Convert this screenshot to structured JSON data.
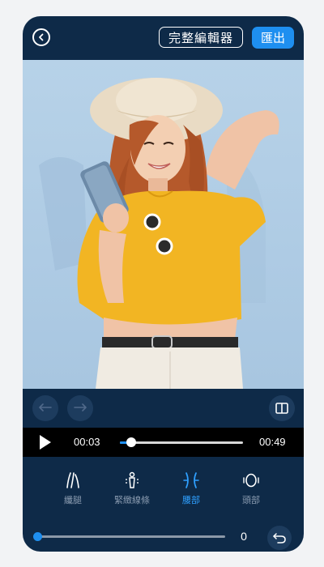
{
  "header": {
    "back_icon": "back-circle-icon",
    "full_editor_label": "完整編輯器",
    "export_label": "匯出"
  },
  "photo": {
    "description_icon": "portrait-photo",
    "colors": {
      "background": "#b4cfe6",
      "shirt": "#f2b523",
      "pants": "#f0ebe2",
      "hat": "#e9dbc4"
    }
  },
  "edit_toolbar": {
    "undo_icon": "undo-arrow-icon",
    "redo_icon": "redo-arrow-icon",
    "compare_icon": "split-compare-icon"
  },
  "player": {
    "play_icon": "play-icon",
    "current_time": "00:03",
    "duration": "00:49",
    "progress": 0.09
  },
  "tools": [
    {
      "label": "纖腿",
      "icon": "slim-legs-icon",
      "active": false
    },
    {
      "label": "緊緻線條",
      "icon": "firm-lines-icon",
      "active": false
    },
    {
      "label": "腰部",
      "icon": "waist-icon",
      "active": true
    },
    {
      "label": "頭部",
      "icon": "head-icon",
      "active": false
    }
  ],
  "intensity": {
    "value": "0",
    "level": 0,
    "reset_icon": "undo-return-icon"
  },
  "colors": {
    "panel": "#0e2a48",
    "accent": "#1e8ff0",
    "muted_text": "#8a9bb0"
  }
}
